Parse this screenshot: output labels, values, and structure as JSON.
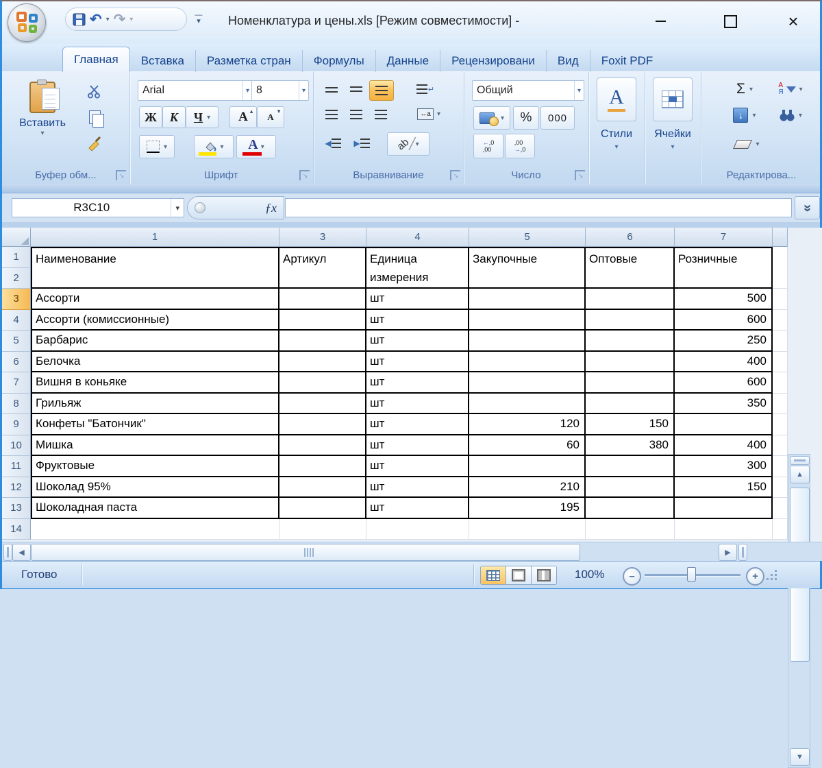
{
  "window": {
    "title": "Номенклатура и цены.xls  [Режим совместимости] -"
  },
  "tabs": {
    "active": "Главная",
    "items": [
      "Главная",
      "Вставка",
      "Разметка стран",
      "Формулы",
      "Данные",
      "Рецензировани",
      "Вид",
      "Foxit PDF"
    ]
  },
  "ribbon": {
    "clipboard": {
      "label": "Буфер обм...",
      "paste": "Вставить"
    },
    "font": {
      "label": "Шрифт",
      "font_name": "Arial",
      "font_size": "8",
      "bold": "Ж",
      "italic": "К",
      "underline": "Ч"
    },
    "alignment": {
      "label": "Выравнивание"
    },
    "number": {
      "label": "Число",
      "format": "Общий",
      "percent": "%",
      "thousands": "000"
    },
    "styles": {
      "label": "Стили"
    },
    "cells": {
      "label": "Ячейки"
    },
    "editing": {
      "label": "Редактирова...",
      "sum": "Σ"
    }
  },
  "formula_bar": {
    "name_box": "R3C10",
    "fx": "ƒx",
    "formula": ""
  },
  "grid": {
    "column_headers": [
      "1",
      "3",
      "4",
      "5",
      "6",
      "7"
    ],
    "row_numbers": [
      "1",
      "2",
      "3",
      "4",
      "5",
      "6",
      "7",
      "8",
      "9",
      "10",
      "11",
      "12",
      "13",
      "14"
    ],
    "selected_row": "3",
    "header_cells": [
      "Наименование",
      "Артикул",
      "Единица измерения",
      "Закупочные",
      "Оптовые",
      "Розничные"
    ],
    "rows": [
      [
        "Ассорти",
        "",
        "шт",
        "",
        "",
        "500"
      ],
      [
        "Ассорти (комиссионные)",
        "",
        "шт",
        "",
        "",
        "600"
      ],
      [
        "Барбарис",
        "",
        "шт",
        "",
        "",
        "250"
      ],
      [
        "Белочка",
        "",
        "шт",
        "",
        "",
        "400"
      ],
      [
        "Вишня в коньяке",
        "",
        "шт",
        "",
        "",
        "600"
      ],
      [
        "Грильяж",
        "",
        "шт",
        "",
        "",
        "350"
      ],
      [
        "Конфеты \"Батончик\"",
        "",
        "шт",
        "120",
        "150",
        ""
      ],
      [
        "Мишка",
        "",
        "шт",
        "60",
        "380",
        "400"
      ],
      [
        "Фруктовые",
        "",
        "шт",
        "",
        "",
        "300"
      ],
      [
        "Шоколад 95%",
        "",
        "шт",
        "210",
        "",
        "150"
      ],
      [
        "Шоколадная паста",
        "",
        "шт",
        "195",
        "",
        ""
      ]
    ]
  },
  "status_bar": {
    "mode": "Готово",
    "zoom_level": "100%"
  }
}
